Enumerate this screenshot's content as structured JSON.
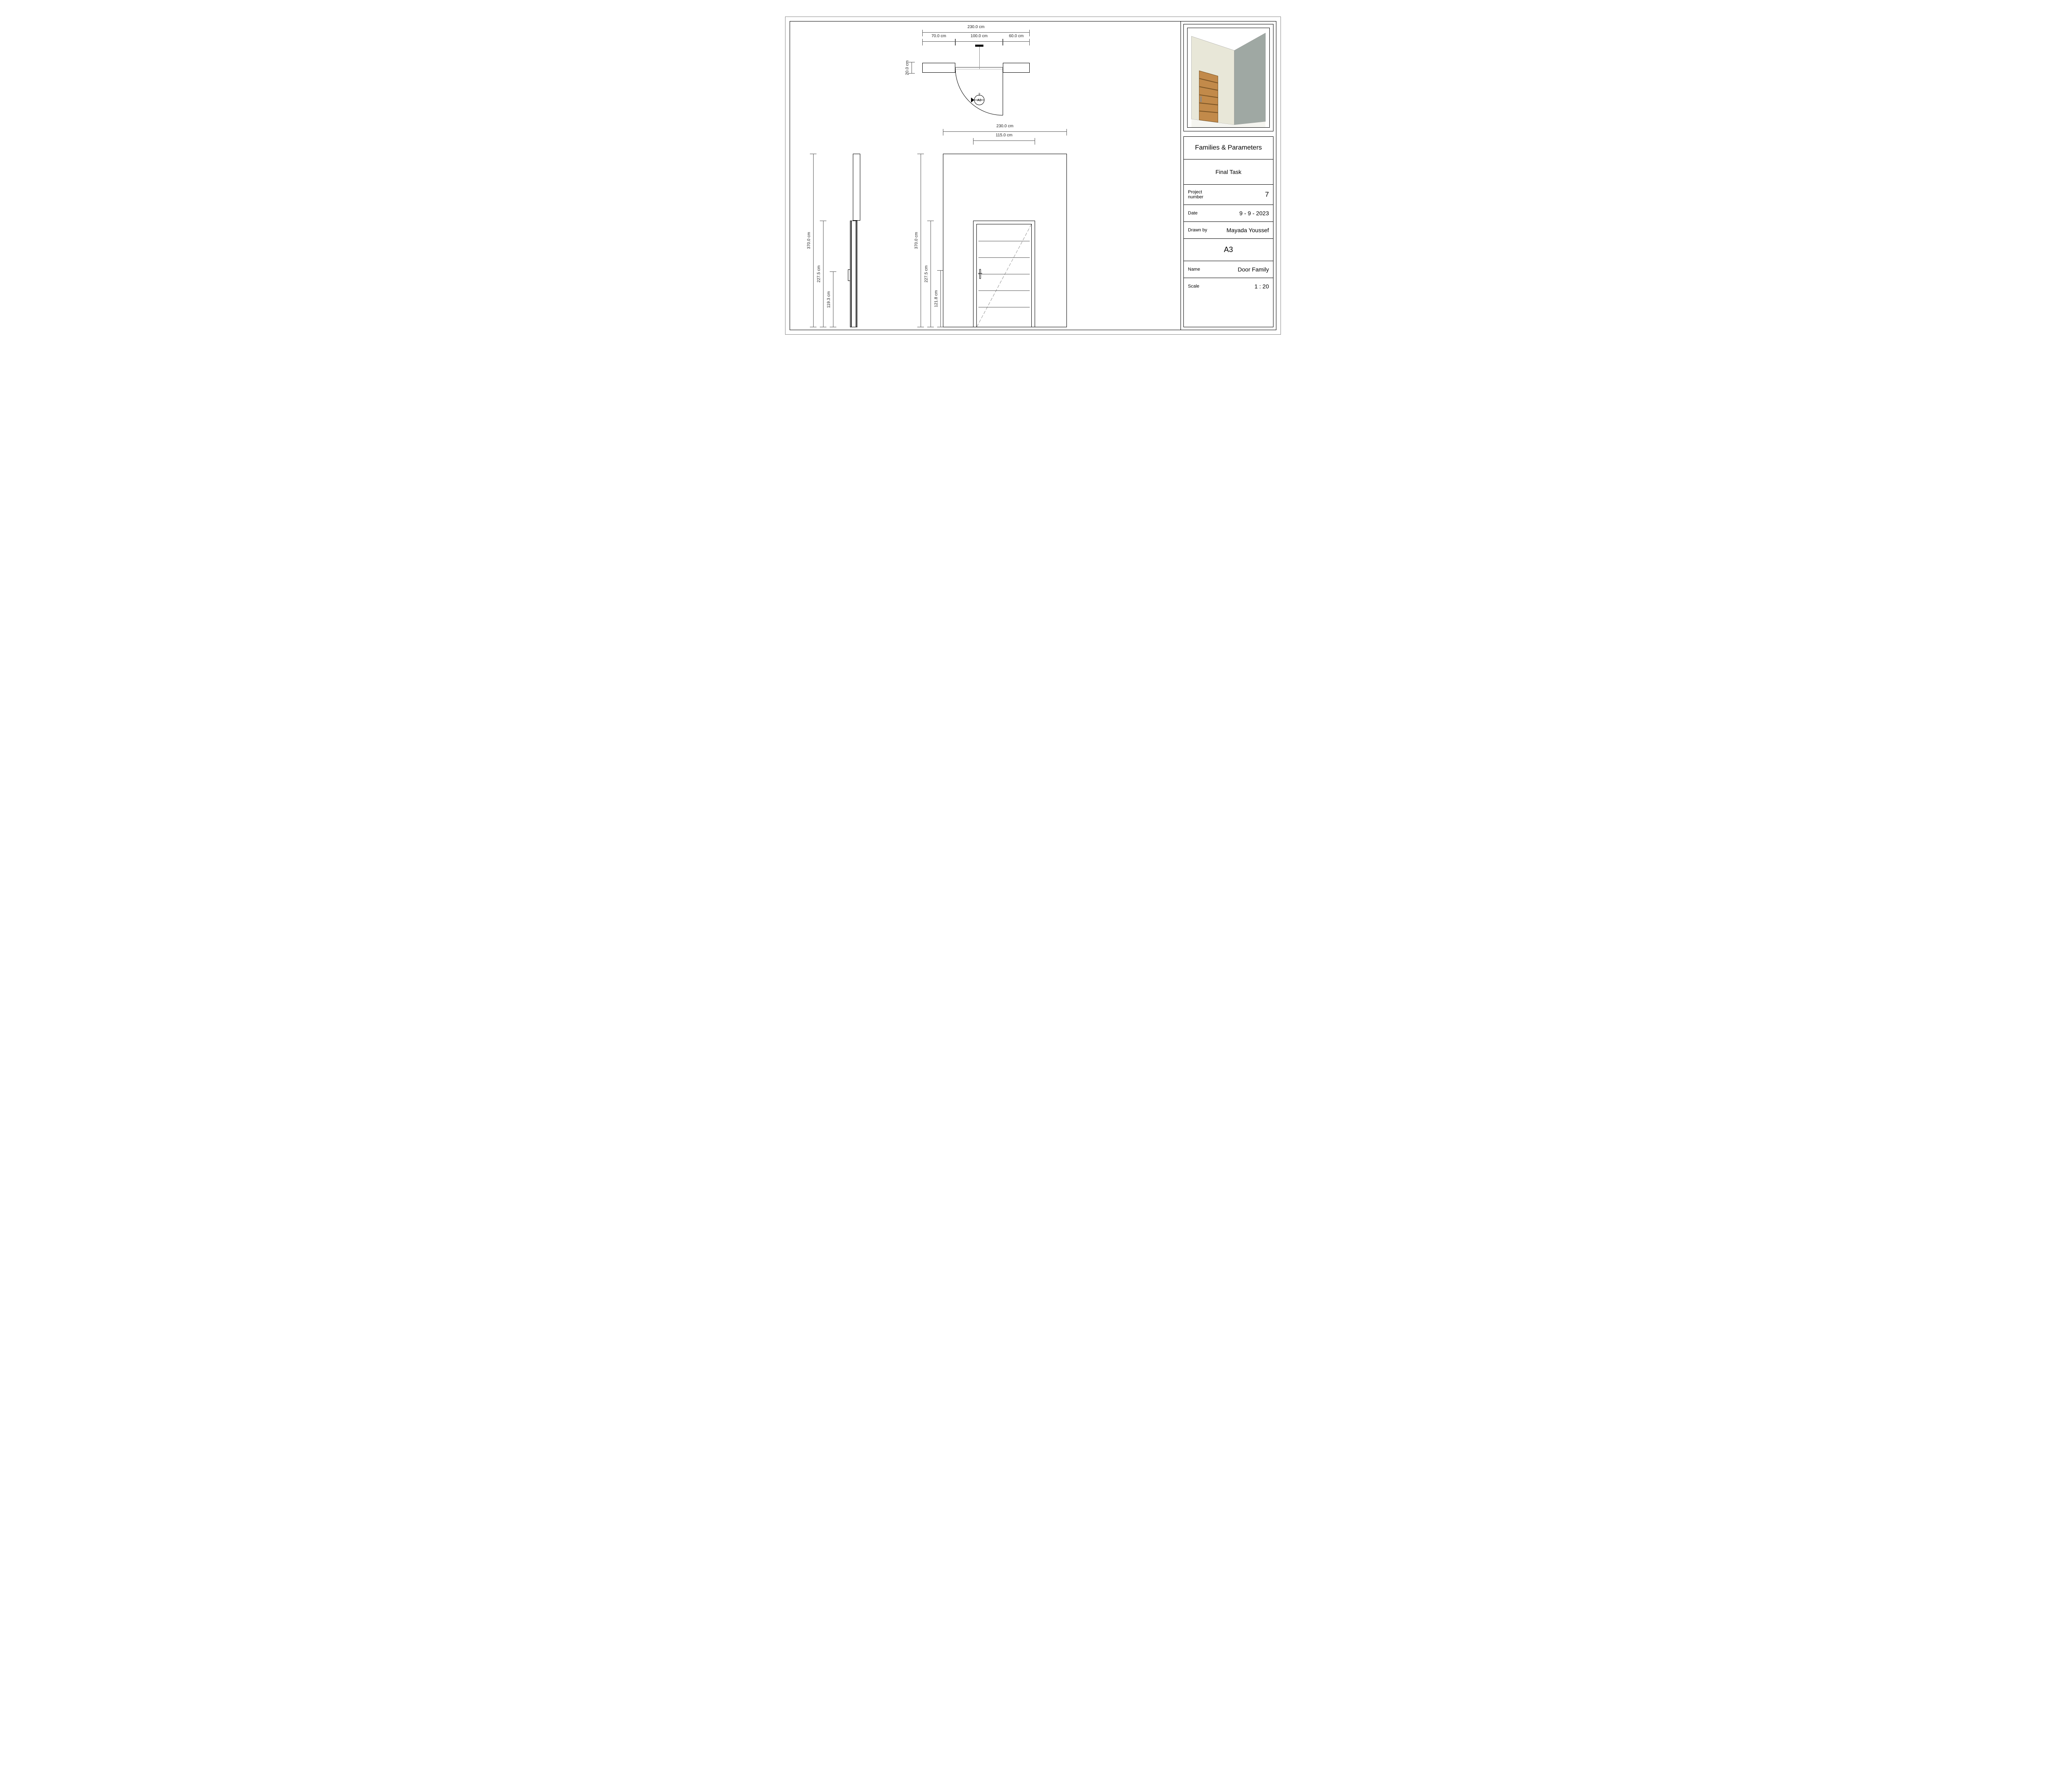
{
  "plan": {
    "dim_total": "230.0 cm",
    "dim_left": "70.0 cm",
    "dim_mid": "100.0 cm",
    "dim_right": "60.0 cm",
    "dim_depth": "20.0 cm",
    "callout_num": "2",
    "callout_sheet": "A3"
  },
  "elevation": {
    "dim_total_w": "230.0 cm",
    "dim_door_w": "115.0 cm",
    "dim_h_total": "370.0 cm",
    "dim_h_door": "227.5 cm",
    "dim_h_handle": "121.8 cm"
  },
  "section": {
    "dim_h_total": "370.0 cm",
    "dim_h_door": "227.5 cm",
    "dim_h_handle": "119.3 cm"
  },
  "titleblock": {
    "title1": "Families & Parameters",
    "title2": "Final Task",
    "proj_lbl": "Project number",
    "proj_val": "7",
    "date_lbl": "Date",
    "date_val": "9 - 9 - 2023",
    "drawn_lbl": "Drawn by",
    "drawn_val": "Mayada Youssef",
    "sheet": "A3",
    "name_lbl": "Name",
    "name_val": "Door Family",
    "scale_lbl": "Scale",
    "scale_val": "1 : 20"
  }
}
